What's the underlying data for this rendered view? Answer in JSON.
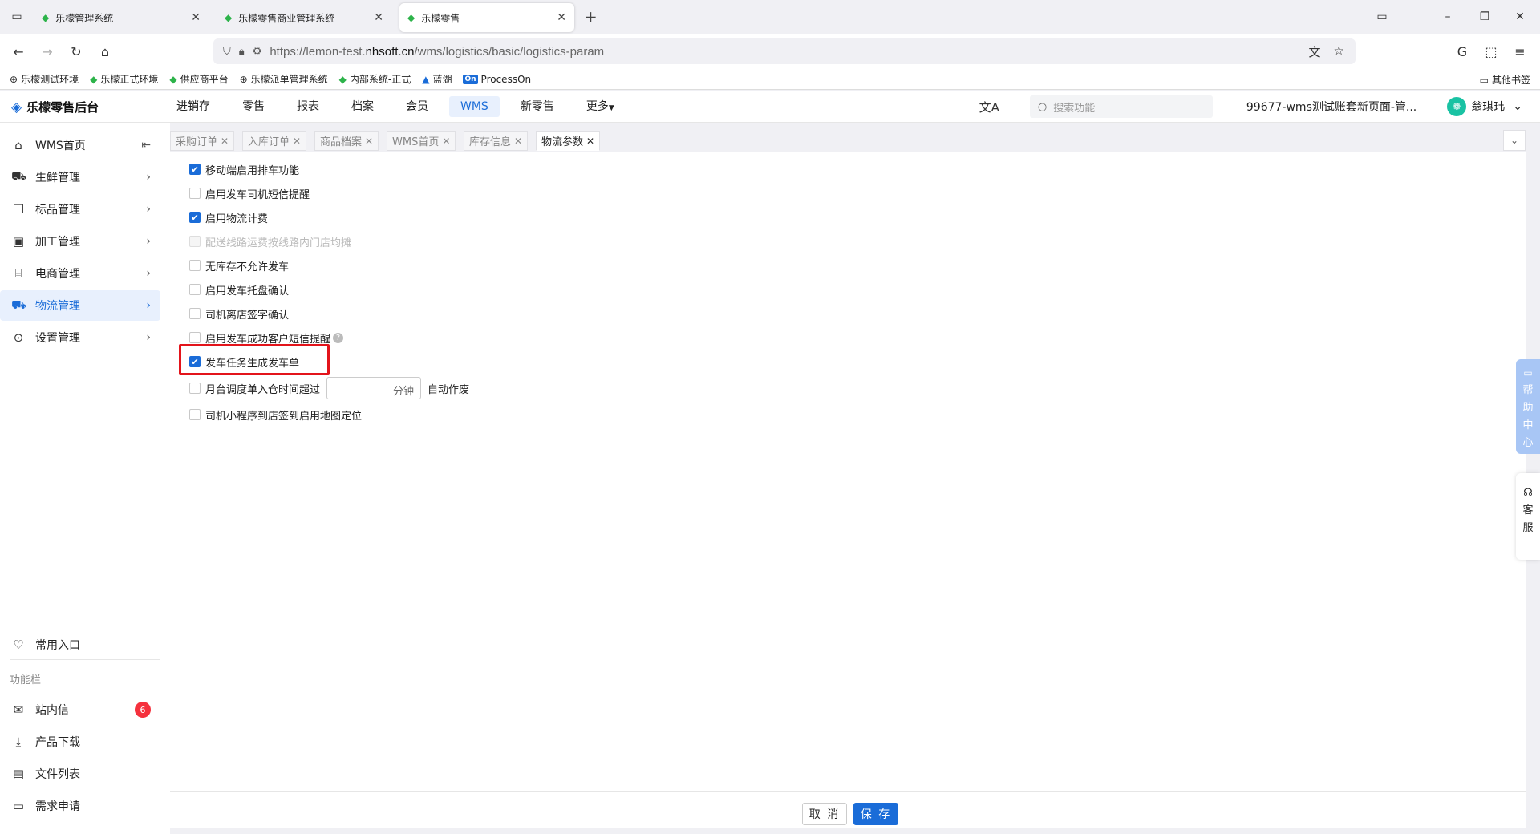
{
  "browser": {
    "tabs": [
      {
        "title": "乐檬管理系统",
        "active": false
      },
      {
        "title": "乐檬零售商业管理系统",
        "active": false
      },
      {
        "title": "乐檬零售",
        "active": true
      }
    ],
    "url_prefix": "https://lemon-test.",
    "url_domain": "nhsoft.cn",
    "url_path": "/wms/logistics/basic/logistics-param",
    "bookmarks": [
      "乐檬测试环境",
      "乐檬正式环境",
      "供应商平台",
      "乐檬派单管理系统",
      "内部系统-正式",
      "蓝湖",
      "ProcessOn"
    ],
    "processon_badge": "On",
    "other_bookmarks": "其他书签"
  },
  "app": {
    "logo_text": "乐檬零售后台",
    "menu": [
      "进销存",
      "零售",
      "报表",
      "档案",
      "会员",
      "WMS",
      "新零售",
      "更多"
    ],
    "active_menu": "WMS",
    "search_placeholder": "搜索功能",
    "account": "99677-wms测试账套新页面-管...",
    "user_name": "翁琪玮"
  },
  "sidebar": {
    "items": [
      {
        "label": "WMS首页",
        "icon": "home-icon"
      },
      {
        "label": "生鲜管理",
        "icon": "fresh-icon"
      },
      {
        "label": "标品管理",
        "icon": "product-icon"
      },
      {
        "label": "加工管理",
        "icon": "process-icon"
      },
      {
        "label": "电商管理",
        "icon": "shop-icon"
      },
      {
        "label": "物流管理",
        "icon": "truck-icon",
        "active": true
      },
      {
        "label": "设置管理",
        "icon": "settings-icon"
      }
    ],
    "favorites": "常用入口",
    "group_label": "功能栏",
    "tools": [
      {
        "label": "站内信",
        "badge": "6"
      },
      {
        "label": "产品下载"
      },
      {
        "label": "文件列表"
      },
      {
        "label": "需求申请"
      }
    ]
  },
  "page_tabs": [
    "采购订单",
    "入库订单",
    "商品档案",
    "WMS首页",
    "库存信息",
    "物流参数"
  ],
  "active_page_tab": "物流参数",
  "settings": [
    {
      "label": "移动端启用排车功能",
      "checked": true
    },
    {
      "label": "启用发车司机短信提醒",
      "checked": false
    },
    {
      "label": "启用物流计费",
      "checked": true
    },
    {
      "label": "配送线路运费按线路内门店均摊",
      "checked": false,
      "disabled": true
    },
    {
      "label": "无库存不允许发车",
      "checked": false
    },
    {
      "label": "启用发车托盘确认",
      "checked": false
    },
    {
      "label": "司机离店签字确认",
      "checked": false
    },
    {
      "label": "启用发车成功客户短信提醒",
      "checked": false
    },
    {
      "label": "发车任务生成发车单",
      "checked": true
    },
    {
      "label": "月台调度单入仓时间超过",
      "checked": false,
      "unit": "分钟",
      "suffix": "自动作废",
      "value": ""
    },
    {
      "label": "司机小程序到店签到启用地图定位",
      "checked": false
    }
  ],
  "footer": {
    "cancel": "取 消",
    "save": "保 存"
  },
  "widgets": {
    "help": [
      "帮",
      "助",
      "中",
      "心"
    ],
    "service": [
      "客",
      "服"
    ]
  },
  "colors": {
    "primary": "#1a6cd8",
    "highlight_border": "#e3141b",
    "badge": "#f5313d"
  }
}
